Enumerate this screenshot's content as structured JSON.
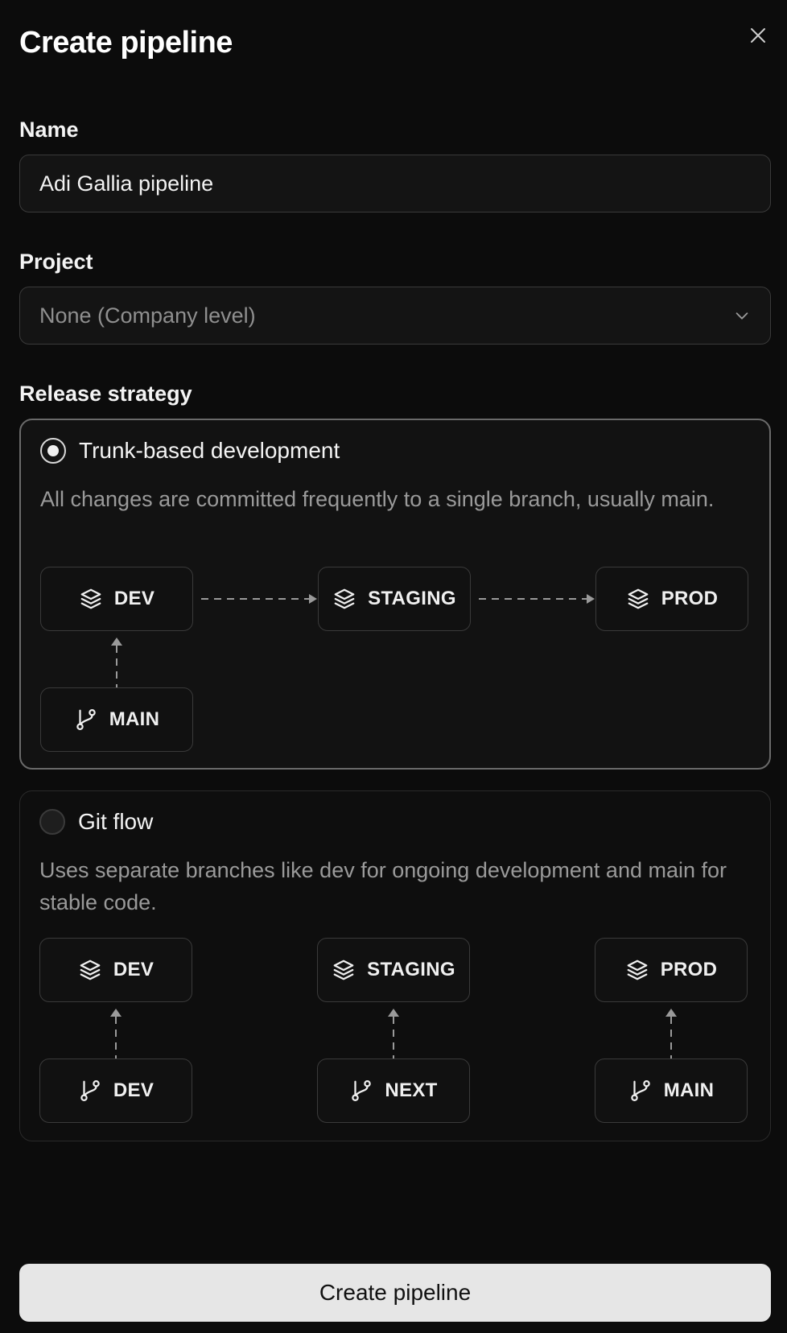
{
  "dialog": {
    "title": "Create pipeline",
    "close_icon": "close-icon"
  },
  "name_field": {
    "label": "Name",
    "value": "Adi Gallia pipeline"
  },
  "project_field": {
    "label": "Project",
    "selected": "None (Company level)",
    "icon": "chevron-down-icon"
  },
  "release_strategy": {
    "label": "Release strategy",
    "options": [
      {
        "label": "Trunk-based development",
        "selected": true,
        "description": "All changes are committed frequently to a single branch, usually main.",
        "environments": [
          "DEV",
          "STAGING",
          "PROD"
        ],
        "branches": [
          "MAIN"
        ]
      },
      {
        "label": "Git flow",
        "selected": false,
        "description": "Uses separate branches like dev for ongoing development and main for stable code.",
        "environments": [
          "DEV",
          "STAGING",
          "PROD"
        ],
        "branches": [
          "DEV",
          "NEXT",
          "MAIN"
        ]
      }
    ]
  },
  "footer": {
    "submit_label": "Create pipeline"
  },
  "colors": {
    "background": "#0c0c0c",
    "text": "#f2f2f2",
    "muted": "#9a9a9a",
    "border": "#3a3a3a",
    "button_bg": "#e6e6e6"
  }
}
